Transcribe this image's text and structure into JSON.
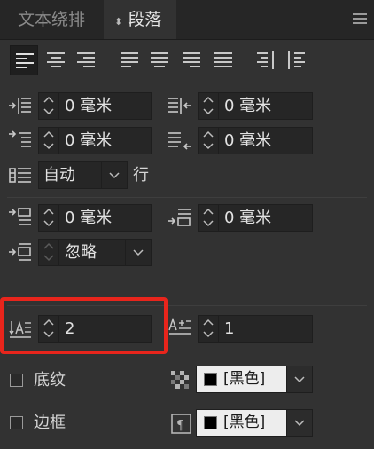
{
  "tabs": {
    "text_wrap": "文本绕排",
    "paragraph": "段落",
    "paragraph_updown": "⬍"
  },
  "indents": {
    "left_indent": "0 毫米",
    "right_indent": "0 毫米",
    "first_line_indent": "0 毫米",
    "last_line_indent": "0 毫米"
  },
  "drop_cap": {
    "mode": "自动",
    "unit_label": "行"
  },
  "spacing": {
    "space_before": "0 毫米",
    "space_after": "0 毫米",
    "grid_align": "忽略"
  },
  "dropcap_counts": {
    "lines": "2",
    "characters": "1"
  },
  "shading": {
    "label": "底纹",
    "color": "[黑色]"
  },
  "border": {
    "label": "边框",
    "color": "[黑色]"
  },
  "colors": {
    "panel_bg": "#323232",
    "highlight": "#e8251c"
  }
}
